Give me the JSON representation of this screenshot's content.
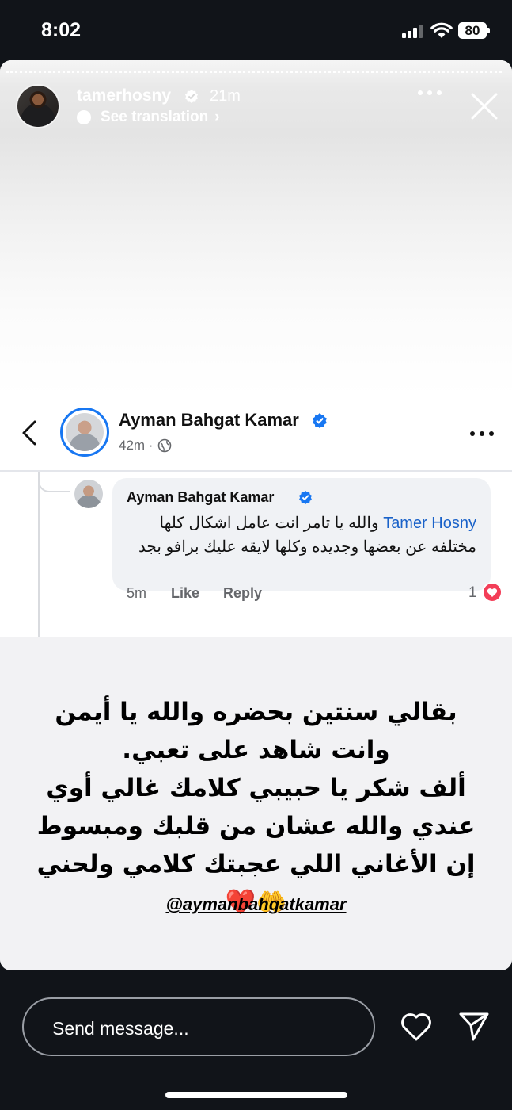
{
  "status_bar": {
    "time": "8:02",
    "battery": "80"
  },
  "story": {
    "username": "tamerhosny",
    "time_ago": "21m",
    "see_translation": "See translation"
  },
  "post": {
    "author": "Ayman Bahgat Kamar",
    "time_ago": "42m ·"
  },
  "comment": {
    "author": "Ayman Bahgat Kamar",
    "mention": "Tamer Hosny",
    "text": " والله يا تامر انت عامل اشكال كلها مختلفه عن بعضها وجديده وكلها لايقه عليك برافو بجد",
    "time_ago": "5m",
    "like_label": "Like",
    "reply_label": "Reply",
    "reaction_count": "1"
  },
  "caption": {
    "text": "بقالي سنتين بحضره والله يا أيمن وانت شاهد على تعبي.\nألف شكر يا حبيبي كلامك غالي أوي عندي والله عشان من قلبك ومبسوط إن الأغاني اللي عجبتك كلامي ولحني 🤲❤️",
    "mention": "@aymanbahgatkamar"
  },
  "bottom_bar": {
    "message_placeholder": "Send message..."
  },
  "colors": {
    "facebook_blue": "#1877f2",
    "mention_blue": "#1a62c9",
    "love_red": "#f33e58"
  }
}
